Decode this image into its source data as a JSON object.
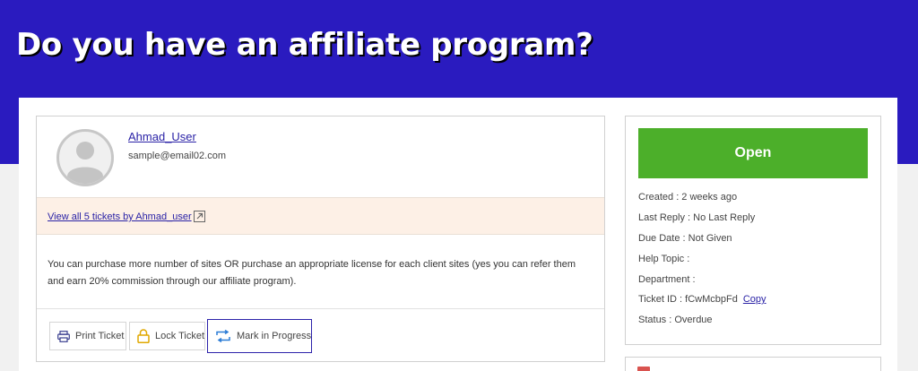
{
  "page": {
    "title": "Do you have an affiliate program?"
  },
  "user": {
    "name": "Ahmad_User",
    "email": "sample@email02.com",
    "tickets_link": "View all 5 tickets by Ahmad_user"
  },
  "message": "You can purchase more number of sites OR purchase an appropriate license for each client sites (yes you can refer them and earn 20% commission through our affiliate program).",
  "actions": {
    "print": "Print Ticket",
    "lock": "Lock Ticket",
    "progress": "Mark in Progress"
  },
  "ticket": {
    "status_button": "Open",
    "created": "Created :  2 weeks ago",
    "last_reply": "Last Reply :  No Last Reply",
    "due_date": "Due Date :  Not Given",
    "help_topic": "Help Topic :",
    "department": "Department :",
    "ticket_id": "Ticket ID :  fCwMcbpFd",
    "copy": "Copy",
    "status": "Status :  Overdue"
  },
  "colors": {
    "hero": "#2a1bbf",
    "open_button": "#4caf2a",
    "link": "#2a22a6",
    "tickets_band": "#fdf0e6"
  },
  "icons": [
    "user-avatar-icon",
    "external-link-icon",
    "printer-icon",
    "lock-icon",
    "progress-arrows-icon",
    "calendar-icon"
  ]
}
